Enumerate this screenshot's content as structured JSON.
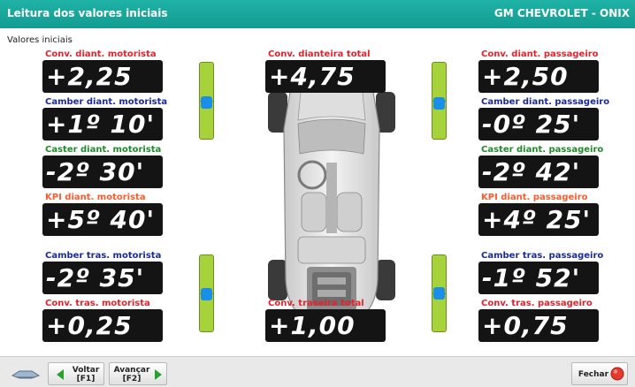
{
  "window": {
    "title": "Leitura dos valores iniciais",
    "vehicle": "GM CHEVROLET - ONIX"
  },
  "section": {
    "title": "Valores iniciais"
  },
  "readings": {
    "conv_diant_motorista": {
      "label": "Conv. diant. motorista",
      "value": "+2,25"
    },
    "camber_diant_motorista": {
      "label": "Camber diant. motorista",
      "value": "+1º 10'"
    },
    "caster_diant_motorista": {
      "label": "Caster diant. motorista",
      "value": "-2º 30'"
    },
    "kpi_diant_motorista": {
      "label": "KPI diant. motorista",
      "value": "+5º 40'"
    },
    "camber_tras_motorista": {
      "label": "Camber tras. motorista",
      "value": "-2º 35'"
    },
    "conv_tras_motorista": {
      "label": "Conv. tras. motorista",
      "value": "+0,25"
    },
    "conv_dianteira_total": {
      "label": "Conv. dianteira total",
      "value": "+4,75"
    },
    "conv_traseira_total": {
      "label": "Conv. traseira total",
      "value": "+1,00"
    },
    "conv_diant_passageiro": {
      "label": "Conv. diant. passageiro",
      "value": "+2,50"
    },
    "camber_diant_passageiro": {
      "label": "Camber diant. passageiro",
      "value": "-0º 25'"
    },
    "caster_diant_passageiro": {
      "label": "Caster diant. passageiro",
      "value": "-2º 42'"
    },
    "kpi_diant_passageiro": {
      "label": "KPI diant. passageiro",
      "value": "+4º 25'"
    },
    "camber_tras_passageiro": {
      "label": "Camber tras. passageiro",
      "value": "-1º 52'"
    },
    "conv_tras_passageiro": {
      "label": "Conv. tras. passageiro",
      "value": "+0,75"
    }
  },
  "colors": {
    "titlebar": "#1fb2a6",
    "gauge_green": "#a6d33b",
    "gauge_marker": "#1a8fe8",
    "conv_label": "#e8202a",
    "camber_label": "#1a2a9a",
    "caster_label": "#1f8a2a",
    "kpi_label": "#ff5a2a"
  },
  "toolbar": {
    "back": {
      "line1": "Voltar",
      "line2": "[F1]"
    },
    "forward": {
      "line1": "Avançar",
      "line2": "[F2]"
    },
    "close": {
      "label": "Fechar"
    },
    "icons": {
      "logo": "car-lift-icon",
      "back": "arrow-left-icon",
      "forward": "arrow-right-icon",
      "close": "red-stop-icon"
    }
  }
}
